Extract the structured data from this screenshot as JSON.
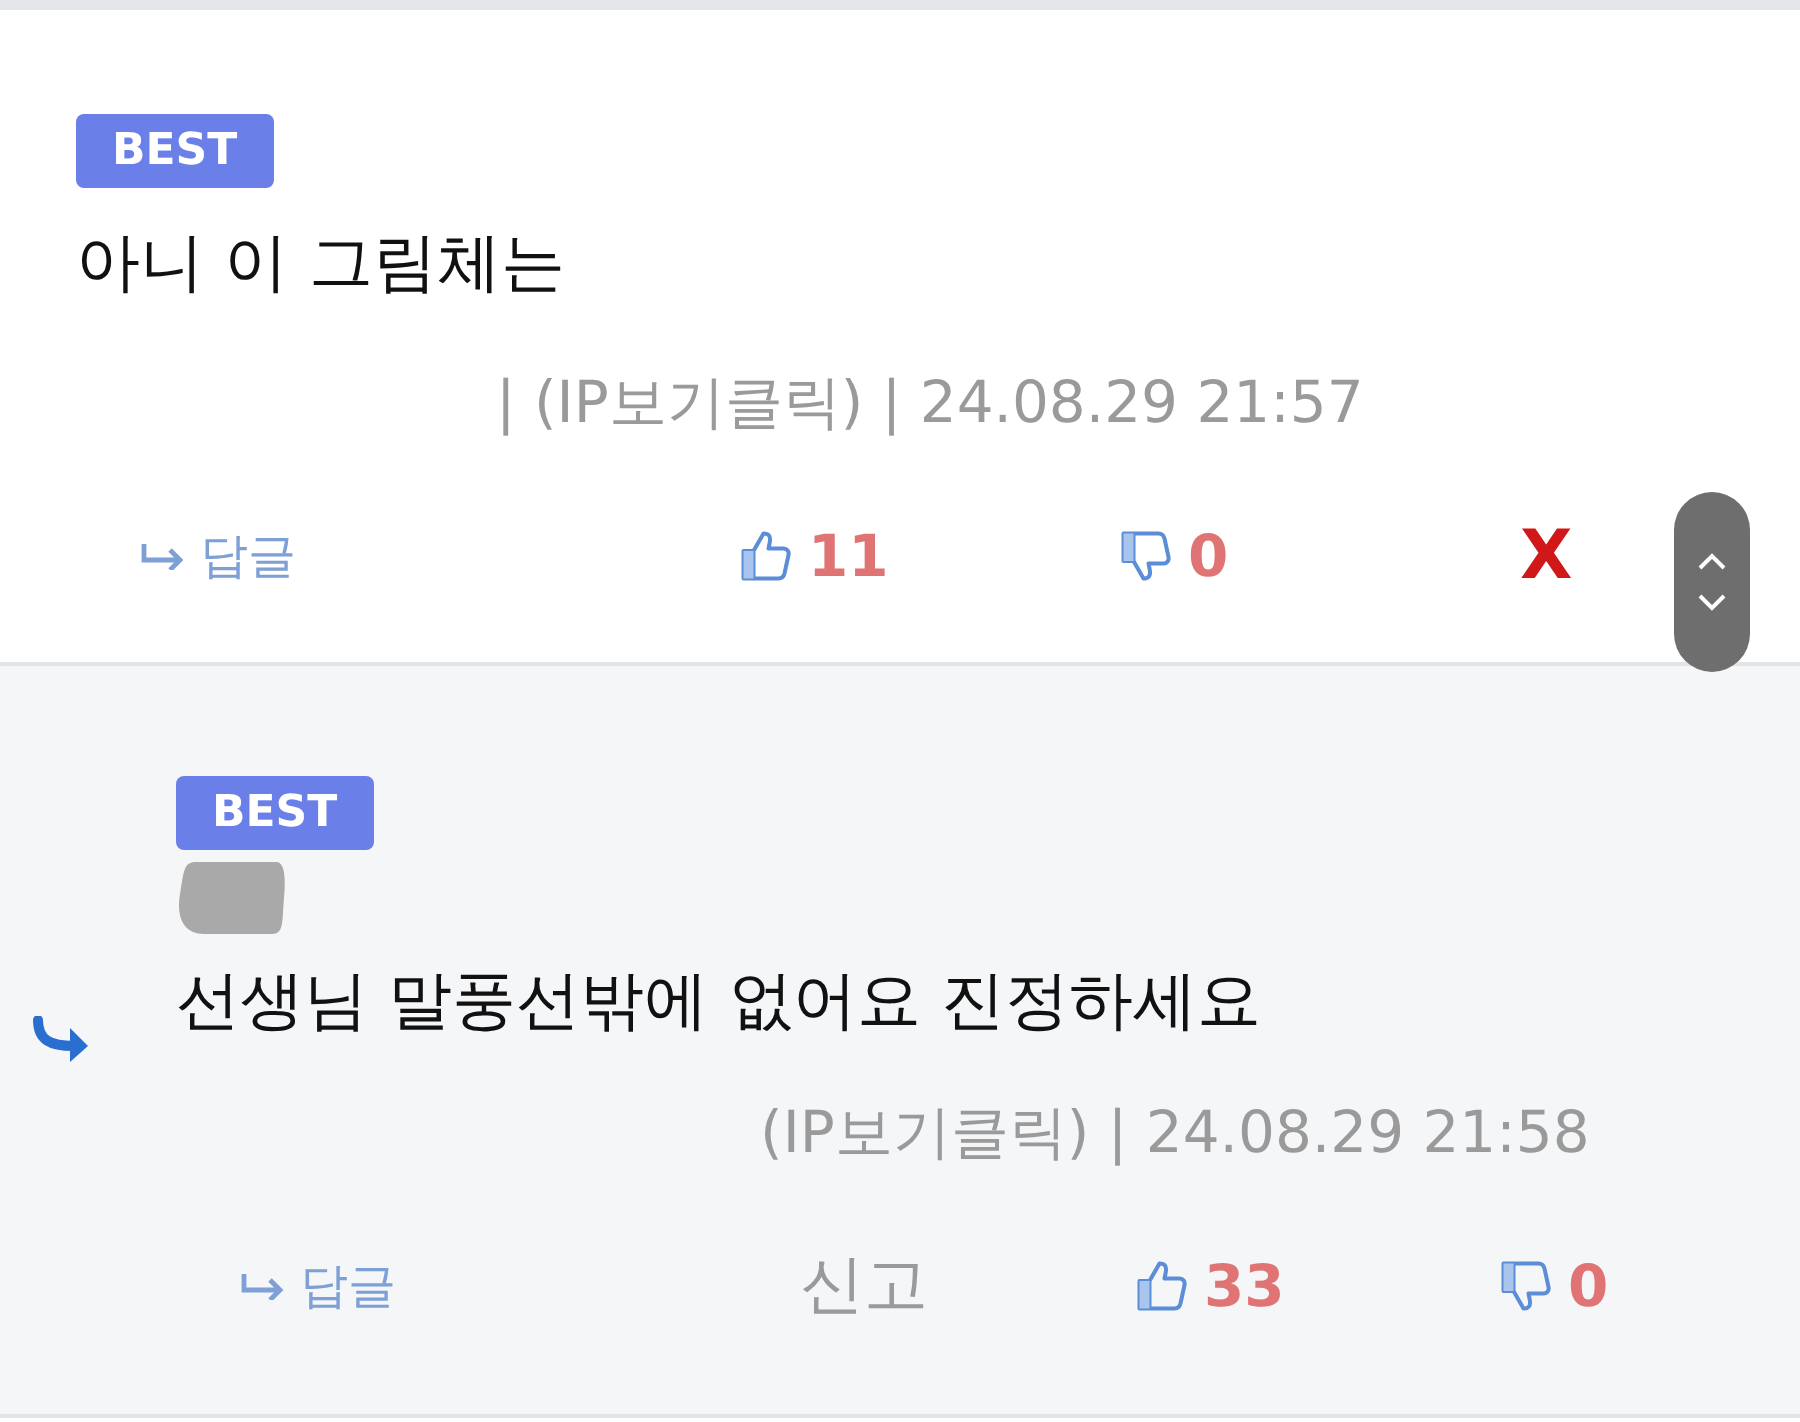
{
  "comments": [
    {
      "kind": "comment",
      "badge": "BEST",
      "text": "아니 이 그림체는",
      "meta": "| (IP보기클릭) | 24.08.29 21:57",
      "reply_label": "답글",
      "likes": "11",
      "dislikes": "0",
      "delete_label": "X"
    },
    {
      "kind": "reply",
      "badge": "BEST",
      "text": "선생님 말풍선밖에 없어요 진정하세요",
      "meta": "(IP보기클릭) | 24.08.29 21:58",
      "reply_label": "답글",
      "report_label": "신고",
      "likes": "33",
      "dislikes": "0"
    }
  ]
}
